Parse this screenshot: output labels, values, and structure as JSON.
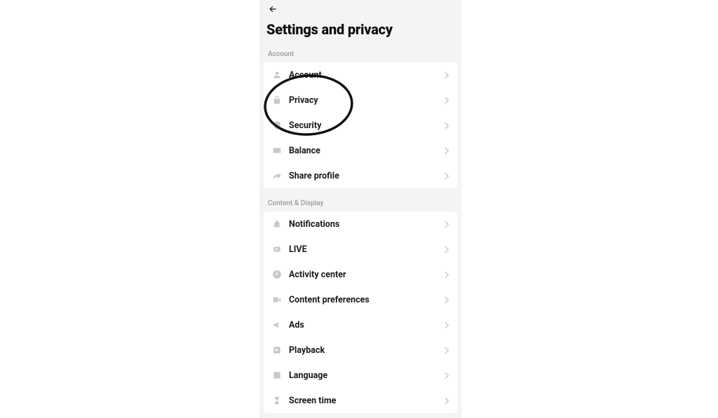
{
  "header": {
    "title": "Settings and privacy"
  },
  "sections": [
    {
      "label": "Account",
      "rows": [
        {
          "icon": "person-icon",
          "name": "row-account",
          "label": "Account"
        },
        {
          "icon": "lock-icon",
          "name": "row-privacy",
          "label": "Privacy"
        },
        {
          "icon": "shield-icon",
          "name": "row-security",
          "label": "Security"
        },
        {
          "icon": "wallet-icon",
          "name": "row-balance",
          "label": "Balance"
        },
        {
          "icon": "share-icon",
          "name": "row-share-profile",
          "label": "Share profile"
        }
      ]
    },
    {
      "label": "Content & Display",
      "rows": [
        {
          "icon": "bell-icon",
          "name": "row-notifications",
          "label": "Notifications"
        },
        {
          "icon": "live-icon",
          "name": "row-live",
          "label": "LIVE"
        },
        {
          "icon": "clock-icon",
          "name": "row-activity-center",
          "label": "Activity center"
        },
        {
          "icon": "video-icon",
          "name": "row-content-preferences",
          "label": "Content preferences"
        },
        {
          "icon": "megaphone-icon",
          "name": "row-ads",
          "label": "Ads"
        },
        {
          "icon": "play-icon",
          "name": "row-playback",
          "label": "Playback"
        },
        {
          "icon": "language-icon",
          "name": "row-language",
          "label": "Language"
        },
        {
          "icon": "hourglass-icon",
          "name": "row-screen-time",
          "label": "Screen time"
        }
      ]
    }
  ],
  "annotation": {
    "target_row": "row-privacy"
  }
}
